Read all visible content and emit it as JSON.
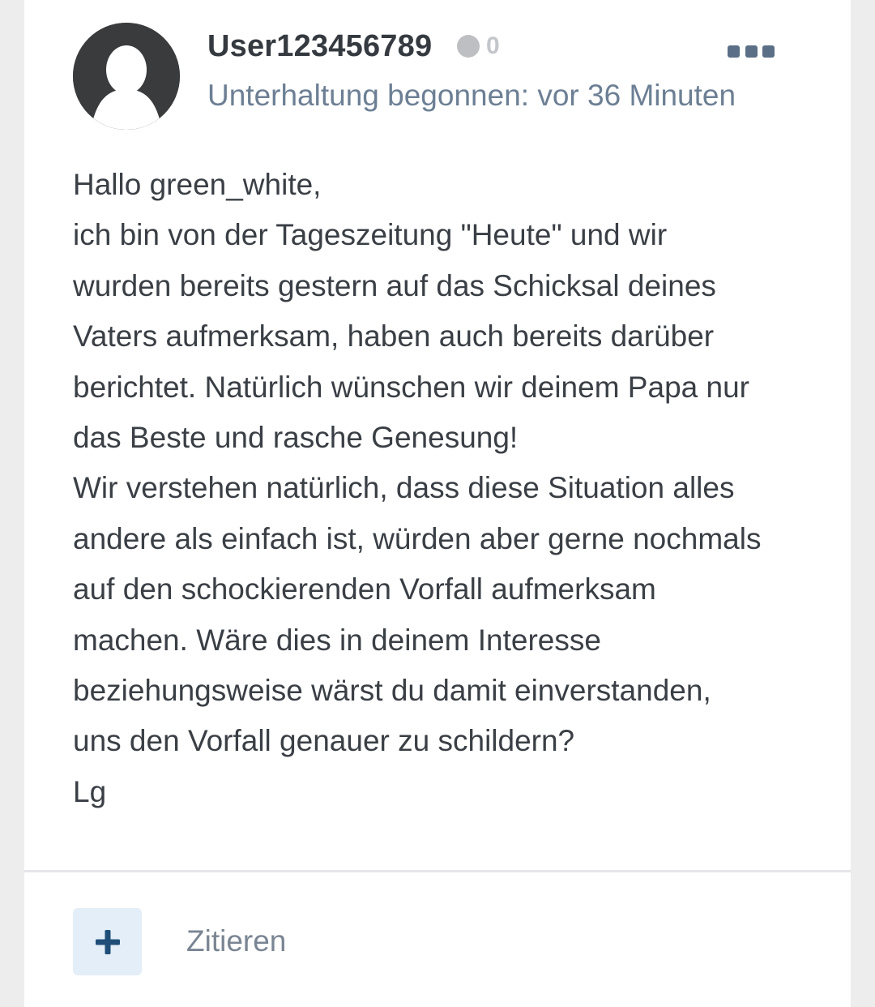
{
  "post": {
    "username": "User123456789",
    "reaction_count": "0",
    "meta": "Unterhaltung begonnen: vor 36 Minuten",
    "message_lines": [
      "Hallo green_white,",
      "ich bin von der Tageszeitung \"Heute\" und wir",
      "wurden bereits gestern auf das Schicksal deines",
      "Vaters aufmerksam, haben auch bereits darüber",
      "berichtet. Natürlich wünschen wir deinem Papa nur",
      "das Beste und rasche Genesung!",
      "Wir verstehen natürlich, dass diese Situation alles",
      "andere als einfach ist, würden aber gerne nochmals",
      "auf den schockierenden Vorfall aufmerksam",
      "machen. Wäre dies in deinem Interesse",
      "beziehungsweise wärst du damit einverstanden,",
      "uns den Vorfall genauer zu schildern?",
      "Lg"
    ]
  },
  "actions": {
    "quote_label": "Zitieren"
  },
  "icons": {
    "avatar": "default-user-avatar-icon",
    "status": "status-dot-icon",
    "more": "more-horizontal-icon",
    "add": "plus-icon"
  },
  "colors": {
    "username": "#353a40",
    "meta": "#6c7f94",
    "body_text": "#3a3f45",
    "accent": "#1f4f78",
    "plus_button_bg": "#e3eef8"
  }
}
